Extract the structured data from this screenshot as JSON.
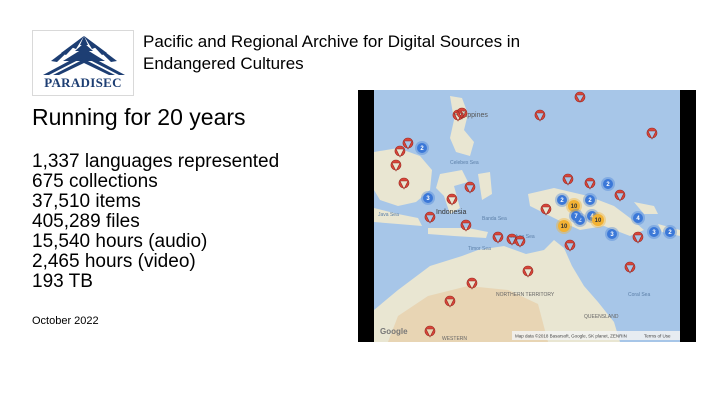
{
  "logo": {
    "text": "PARADISEC",
    "icon": "mountain-rays-logo",
    "colors": {
      "primary": "#1d3e73"
    }
  },
  "header": {
    "title": "Pacific and Regional Archive for Digital Sources in Endangered Cultures"
  },
  "subtitle": "Running for 20 years",
  "stats": [
    "1,337 languages represented",
    "675 collections",
    "37,510 items",
    "405,289 files",
    "15,540 hours (audio)",
    "2,465 hours (video)",
    "193 TB"
  ],
  "date": "October 2022",
  "map": {
    "labels": {
      "philippines": "Philippines",
      "celebes_sea": "Celebes Sea",
      "indonesia": "Indonesia",
      "banda_sea": "Banda Sea",
      "timor_sea": "Timor Sea",
      "java_sea": "Java Sea",
      "arafura_sea": "Arafura Sea",
      "northern_territory": "NORTHERN TERRITORY",
      "queensland": "QUEENSLAND",
      "coral_sea": "Coral Sea",
      "western": "WESTERN",
      "google": "Google",
      "attribution": "Map data ©2018 Basarsoft, Google, SK planet, ZENRIN",
      "terms": "Terms of Use"
    },
    "colors": {
      "sea": "#a7c6e8",
      "land": "#e9e6d2",
      "desert": "#e8c79a",
      "pin": "#d9453a",
      "cluster": "#3b78d8",
      "cluster_warm": "#f2b233"
    },
    "clusters": [
      "2",
      "3",
      "2",
      "10",
      "2",
      "10",
      "2",
      "7",
      "4",
      "10",
      "2",
      "3",
      "4",
      "3",
      "2"
    ]
  }
}
